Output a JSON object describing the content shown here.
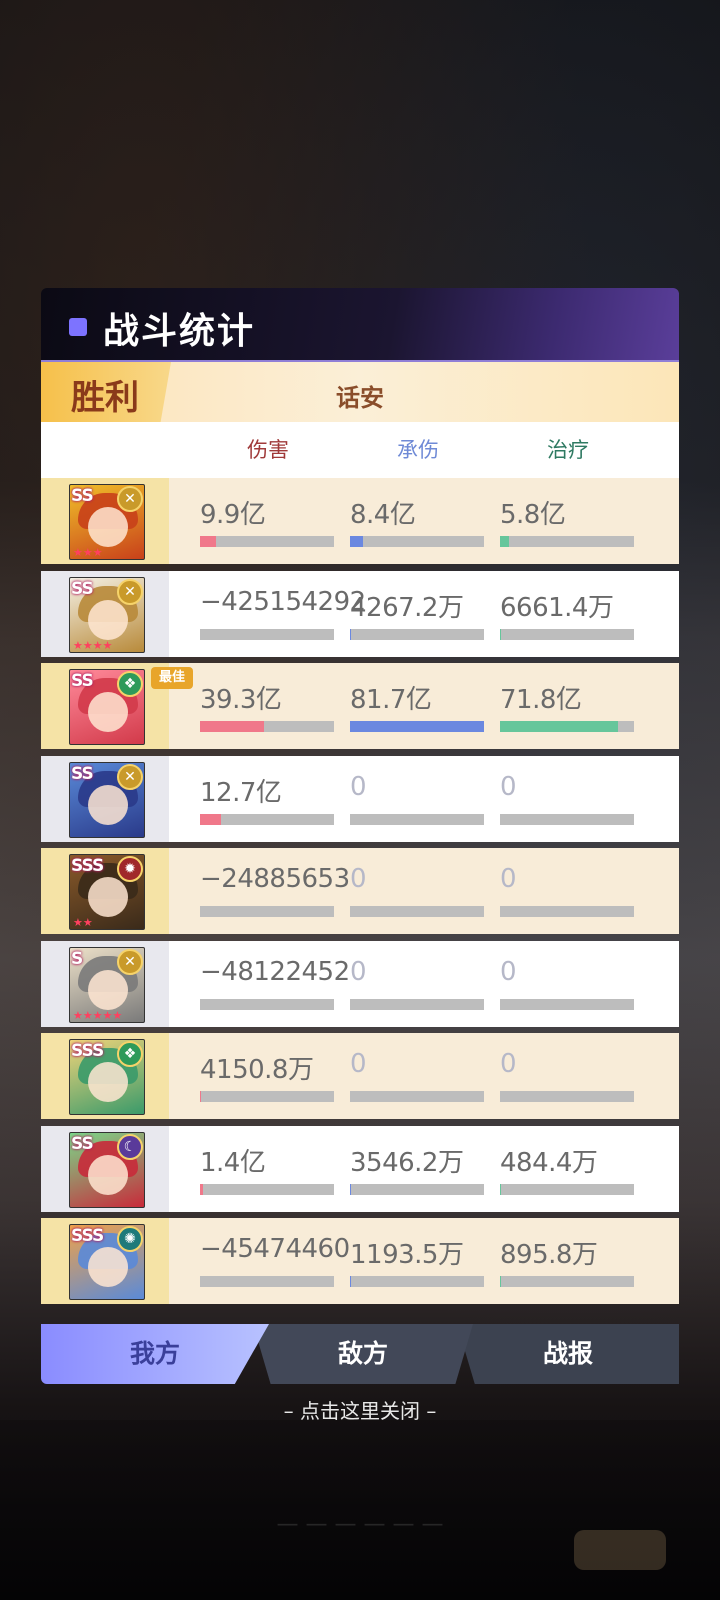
{
  "header": {
    "title": "战斗统计"
  },
  "result": {
    "outcome": "胜利",
    "player_name": "话安"
  },
  "columns": {
    "damage": "伤害",
    "taken": "承伤",
    "heal": "治疗"
  },
  "best_tag": "最佳",
  "colors": {
    "damage": "#f0788a",
    "taken": "#6b88e0",
    "heal": "#66c69b",
    "accent": "#7d73ff"
  },
  "rows": [
    {
      "rank": "SS",
      "element": "light",
      "stars": "★★★",
      "damage": "9.9亿",
      "damage_pct": 0.12,
      "taken": "8.4亿",
      "taken_pct": 0.1,
      "heal": "5.8亿",
      "heal_pct": 0.07
    },
    {
      "rank": "SS",
      "element": "light",
      "stars": "★★★★",
      "damage": "−425154292",
      "damage_pct": 0.0,
      "taken": "4267.2万",
      "taken_pct": 0.005,
      "heal": "6661.4万",
      "heal_pct": 0.01
    },
    {
      "rank": "SS",
      "element": "nature",
      "stars": "",
      "damage": "39.3亿",
      "damage_pct": 0.48,
      "taken": "81.7亿",
      "taken_pct": 1.0,
      "heal": "71.8亿",
      "heal_pct": 0.88,
      "best": true
    },
    {
      "rank": "SS",
      "element": "light",
      "stars": "",
      "damage": "12.7亿",
      "damage_pct": 0.16,
      "taken": "0",
      "taken_pct": 0.0,
      "heal": "0",
      "heal_pct": 0.0
    },
    {
      "rank": "SSS",
      "element": "fire",
      "stars": "★★",
      "damage": "−24885653",
      "damage_pct": 0.0,
      "taken": "0",
      "taken_pct": 0.0,
      "heal": "0",
      "heal_pct": 0.0
    },
    {
      "rank": "S",
      "element": "light",
      "stars": "★★★★★",
      "damage": "−48122452",
      "damage_pct": 0.0,
      "taken": "0",
      "taken_pct": 0.0,
      "heal": "0",
      "heal_pct": 0.0
    },
    {
      "rank": "SSS",
      "element": "nature",
      "stars": "",
      "damage": "4150.8万",
      "damage_pct": 0.005,
      "taken": "0",
      "taken_pct": 0.0,
      "heal": "0",
      "heal_pct": 0.0
    },
    {
      "rank": "SS",
      "element": "dark",
      "stars": "",
      "damage": "1.4亿",
      "damage_pct": 0.02,
      "taken": "3546.2万",
      "taken_pct": 0.004,
      "heal": "484.4万",
      "heal_pct": 0.001
    },
    {
      "rank": "SSS",
      "element": "water",
      "stars": "",
      "damage": "−45474460",
      "damage_pct": 0.0,
      "taken": "1193.5万",
      "taken_pct": 0.002,
      "heal": "895.8万",
      "heal_pct": 0.001
    }
  ],
  "tabs": {
    "mine": "我方",
    "enemy": "敌方",
    "report": "战报"
  },
  "close_hint": "– 点击这里关闭 –"
}
